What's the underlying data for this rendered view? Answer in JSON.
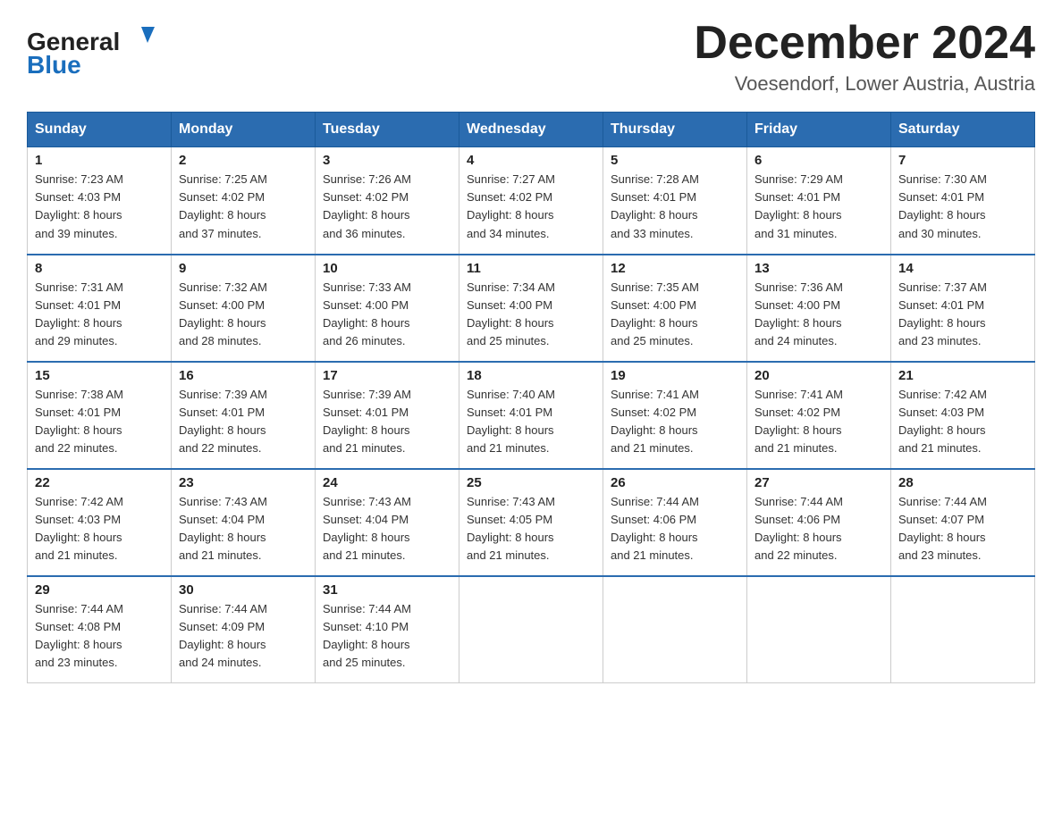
{
  "header": {
    "logo_line1": "General",
    "logo_line2": "Blue",
    "month_title": "December 2024",
    "location": "Voesendorf, Lower Austria, Austria"
  },
  "weekdays": [
    "Sunday",
    "Monday",
    "Tuesday",
    "Wednesday",
    "Thursday",
    "Friday",
    "Saturday"
  ],
  "weeks": [
    [
      {
        "day": "1",
        "info": "Sunrise: 7:23 AM\nSunset: 4:03 PM\nDaylight: 8 hours\nand 39 minutes."
      },
      {
        "day": "2",
        "info": "Sunrise: 7:25 AM\nSunset: 4:02 PM\nDaylight: 8 hours\nand 37 minutes."
      },
      {
        "day": "3",
        "info": "Sunrise: 7:26 AM\nSunset: 4:02 PM\nDaylight: 8 hours\nand 36 minutes."
      },
      {
        "day": "4",
        "info": "Sunrise: 7:27 AM\nSunset: 4:02 PM\nDaylight: 8 hours\nand 34 minutes."
      },
      {
        "day": "5",
        "info": "Sunrise: 7:28 AM\nSunset: 4:01 PM\nDaylight: 8 hours\nand 33 minutes."
      },
      {
        "day": "6",
        "info": "Sunrise: 7:29 AM\nSunset: 4:01 PM\nDaylight: 8 hours\nand 31 minutes."
      },
      {
        "day": "7",
        "info": "Sunrise: 7:30 AM\nSunset: 4:01 PM\nDaylight: 8 hours\nand 30 minutes."
      }
    ],
    [
      {
        "day": "8",
        "info": "Sunrise: 7:31 AM\nSunset: 4:01 PM\nDaylight: 8 hours\nand 29 minutes."
      },
      {
        "day": "9",
        "info": "Sunrise: 7:32 AM\nSunset: 4:00 PM\nDaylight: 8 hours\nand 28 minutes."
      },
      {
        "day": "10",
        "info": "Sunrise: 7:33 AM\nSunset: 4:00 PM\nDaylight: 8 hours\nand 26 minutes."
      },
      {
        "day": "11",
        "info": "Sunrise: 7:34 AM\nSunset: 4:00 PM\nDaylight: 8 hours\nand 25 minutes."
      },
      {
        "day": "12",
        "info": "Sunrise: 7:35 AM\nSunset: 4:00 PM\nDaylight: 8 hours\nand 25 minutes."
      },
      {
        "day": "13",
        "info": "Sunrise: 7:36 AM\nSunset: 4:00 PM\nDaylight: 8 hours\nand 24 minutes."
      },
      {
        "day": "14",
        "info": "Sunrise: 7:37 AM\nSunset: 4:01 PM\nDaylight: 8 hours\nand 23 minutes."
      }
    ],
    [
      {
        "day": "15",
        "info": "Sunrise: 7:38 AM\nSunset: 4:01 PM\nDaylight: 8 hours\nand 22 minutes."
      },
      {
        "day": "16",
        "info": "Sunrise: 7:39 AM\nSunset: 4:01 PM\nDaylight: 8 hours\nand 22 minutes."
      },
      {
        "day": "17",
        "info": "Sunrise: 7:39 AM\nSunset: 4:01 PM\nDaylight: 8 hours\nand 21 minutes."
      },
      {
        "day": "18",
        "info": "Sunrise: 7:40 AM\nSunset: 4:01 PM\nDaylight: 8 hours\nand 21 minutes."
      },
      {
        "day": "19",
        "info": "Sunrise: 7:41 AM\nSunset: 4:02 PM\nDaylight: 8 hours\nand 21 minutes."
      },
      {
        "day": "20",
        "info": "Sunrise: 7:41 AM\nSunset: 4:02 PM\nDaylight: 8 hours\nand 21 minutes."
      },
      {
        "day": "21",
        "info": "Sunrise: 7:42 AM\nSunset: 4:03 PM\nDaylight: 8 hours\nand 21 minutes."
      }
    ],
    [
      {
        "day": "22",
        "info": "Sunrise: 7:42 AM\nSunset: 4:03 PM\nDaylight: 8 hours\nand 21 minutes."
      },
      {
        "day": "23",
        "info": "Sunrise: 7:43 AM\nSunset: 4:04 PM\nDaylight: 8 hours\nand 21 minutes."
      },
      {
        "day": "24",
        "info": "Sunrise: 7:43 AM\nSunset: 4:04 PM\nDaylight: 8 hours\nand 21 minutes."
      },
      {
        "day": "25",
        "info": "Sunrise: 7:43 AM\nSunset: 4:05 PM\nDaylight: 8 hours\nand 21 minutes."
      },
      {
        "day": "26",
        "info": "Sunrise: 7:44 AM\nSunset: 4:06 PM\nDaylight: 8 hours\nand 21 minutes."
      },
      {
        "day": "27",
        "info": "Sunrise: 7:44 AM\nSunset: 4:06 PM\nDaylight: 8 hours\nand 22 minutes."
      },
      {
        "day": "28",
        "info": "Sunrise: 7:44 AM\nSunset: 4:07 PM\nDaylight: 8 hours\nand 23 minutes."
      }
    ],
    [
      {
        "day": "29",
        "info": "Sunrise: 7:44 AM\nSunset: 4:08 PM\nDaylight: 8 hours\nand 23 minutes."
      },
      {
        "day": "30",
        "info": "Sunrise: 7:44 AM\nSunset: 4:09 PM\nDaylight: 8 hours\nand 24 minutes."
      },
      {
        "day": "31",
        "info": "Sunrise: 7:44 AM\nSunset: 4:10 PM\nDaylight: 8 hours\nand 25 minutes."
      },
      {
        "day": "",
        "info": ""
      },
      {
        "day": "",
        "info": ""
      },
      {
        "day": "",
        "info": ""
      },
      {
        "day": "",
        "info": ""
      }
    ]
  ]
}
